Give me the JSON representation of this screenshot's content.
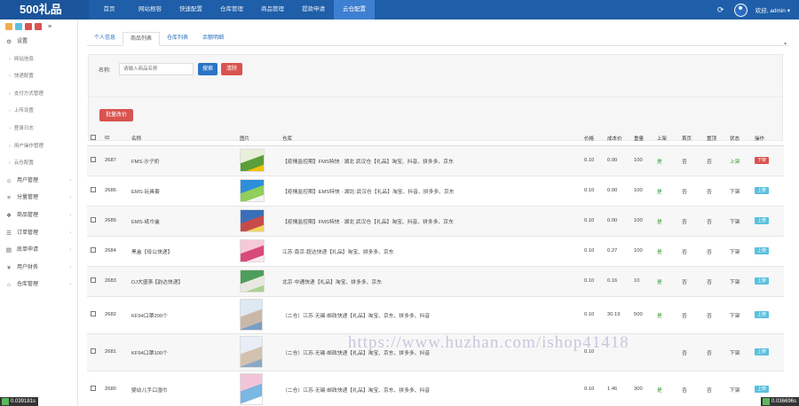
{
  "app": {
    "brand": "500礼品"
  },
  "nav": [
    "首页",
    "网站根容",
    "快速配置",
    "仓库管理",
    "商品管理",
    "提款申请",
    "云仓配置"
  ],
  "nav_active": 6,
  "user": {
    "label": "欢迎, admin ▾"
  },
  "sidebar": {
    "shortcut_colors": [
      "#f0ad4e",
      "#5bc0de",
      "#d9534f",
      "#d9534f"
    ],
    "groups": [
      {
        "label": "设置",
        "icon": "gear-icon",
        "items": [
          "网站信息",
          "快递配置",
          "支付方式管理",
          "上传设置",
          "登录日志",
          "用户操作管理",
          "云仓配置"
        ]
      },
      {
        "label": "用户管理",
        "icon": "user-icon"
      },
      {
        "label": "分量管理",
        "icon": "stack-icon"
      },
      {
        "label": "商品管理",
        "icon": "box-icon"
      },
      {
        "label": "订单管理",
        "icon": "order-icon"
      },
      {
        "label": "底单申请",
        "icon": "doc-icon"
      },
      {
        "label": "用户财务",
        "icon": "yen-icon"
      },
      {
        "label": "仓库管理",
        "icon": "warehouse-icon"
      }
    ]
  },
  "tabs": [
    "个人信息",
    "商品列表",
    "仓库列表",
    "余额明细"
  ],
  "active_tab": 1,
  "search": {
    "label": "名称:",
    "placeholder": "请输入商品名称",
    "search_button": "搜索",
    "reset_button": "清除"
  },
  "batch_button": "批量改价",
  "table": {
    "columns": [
      "",
      "ID",
      "名称",
      "图片",
      "仓库",
      "价格",
      "成本价",
      "重量",
      "上架",
      "首页",
      "置顶",
      "状态",
      "操作"
    ],
    "rows": [
      {
        "id": "2687",
        "name": "FMS·沙子奶",
        "warehouse": "【疫情监控期】FMS特快 · 湖北 武汉仓【礼品】淘宝、抖音、拼多多、京东",
        "price": "0.10",
        "cost": "0.00",
        "weight": "100",
        "on": "是",
        "home": "否",
        "top": "否",
        "status": "上架",
        "status_color": "#3aa23a",
        "action": "下架",
        "action_badge": "red",
        "img": [
          "#e8f0d8",
          "#5a9e3a",
          "#f2c200"
        ]
      },
      {
        "id": "2686",
        "name": "EMS·玩具套",
        "warehouse": "【疫情监控期】EMS特快 · 湖北·武汉仓【礼品】淘宝、抖音、拼多多、京东",
        "price": "0.10",
        "cost": "0.00",
        "weight": "100",
        "on": "是",
        "home": "否",
        "top": "否",
        "status": "下架",
        "status_color": "#444",
        "action": "上架",
        "action_badge": "cyan",
        "img": [
          "#2d8fd9",
          "#8fcf5a",
          "#f4f4f4"
        ]
      },
      {
        "id": "2685",
        "name": "EMS·纸巾盒",
        "warehouse": "【疫情监控期】FMS特快 · 湖北 武汉仓【礼品】淘宝、抖音、拼多多、京东",
        "price": "0.10",
        "cost": "0.00",
        "weight": "100",
        "on": "是",
        "home": "否",
        "top": "否",
        "status": "下架",
        "status_color": "#444",
        "action": "上架",
        "action_badge": "cyan",
        "img": [
          "#3a6fb8",
          "#c84b4b",
          "#f2d35a"
        ]
      },
      {
        "id": "2684",
        "name": "黑盒【母公快递】",
        "warehouse": "江苏·南京·超达快递【礼品】淘宝、拼多多、京东",
        "price": "0.10",
        "cost": "0.27",
        "weight": "100",
        "on": "是",
        "home": "否",
        "top": "否",
        "status": "下架",
        "status_color": "#444",
        "action": "上架",
        "action_badge": "cyan",
        "img": [
          "#f5c9d8",
          "#d94a7a",
          "#ffe6ee"
        ]
      },
      {
        "id": "2683",
        "name": "DJ大盛茶·【韵达快递】",
        "warehouse": "北京·中通快递【礼品】淘宝、拼多多、京东",
        "price": "0.10",
        "cost": "0.16",
        "weight": "10",
        "on": "是",
        "home": "否",
        "top": "否",
        "status": "下架",
        "status_color": "#444",
        "action": "上架",
        "action_badge": "cyan",
        "img": [
          "#4d9e5a",
          "#e8e8e0",
          "#a9d18e"
        ]
      },
      {
        "id": "2682",
        "name": "KF94口罩200个",
        "warehouse": "（二仓）江苏·无锡·邮政快递【礼品】淘宝、京东、拼多多、抖音",
        "price": "0.10",
        "cost": "30.19",
        "weight": "500",
        "on": "是",
        "home": "否",
        "top": "否",
        "status": "下架",
        "status_color": "#444",
        "action": "上架",
        "action_badge": "cyan",
        "img": [
          "#dfe9f2",
          "#c9b8a8",
          "#7a9ec7"
        ],
        "tall": true
      },
      {
        "id": "2681",
        "name": "KF94口罩100个",
        "warehouse": "（二仓）江苏·无锡·邮政快递【礼品】淘宝、京东、拼多多、抖音",
        "price": "0.10",
        "cost": "",
        "weight": "",
        "on": "",
        "home": "否",
        "top": "否",
        "status": "下架",
        "status_color": "#444",
        "action": "上架",
        "action_badge": "cyan",
        "img": [
          "#e7eef5",
          "#d3c2b0",
          "#8aa8c8"
        ],
        "tall": true
      },
      {
        "id": "2680",
        "name": "婴幼儿手口湿巾",
        "warehouse": "（二仓）江苏·无锡·邮政快递【礼品】淘宝、京东、拼多多、抖音",
        "price": "0.10",
        "cost": "1.46",
        "weight": "300",
        "on": "是",
        "home": "否",
        "top": "否",
        "status": "下架",
        "status_color": "#444",
        "action": "上架",
        "action_badge": "cyan",
        "img": [
          "#f3c4d9",
          "#7ab7e3",
          "#ffffff"
        ],
        "tall": true
      }
    ]
  },
  "fps_left": "0.039181s",
  "fps_right": "0.036696s",
  "watermark": "https://www.huzhan.com/ishop41418"
}
